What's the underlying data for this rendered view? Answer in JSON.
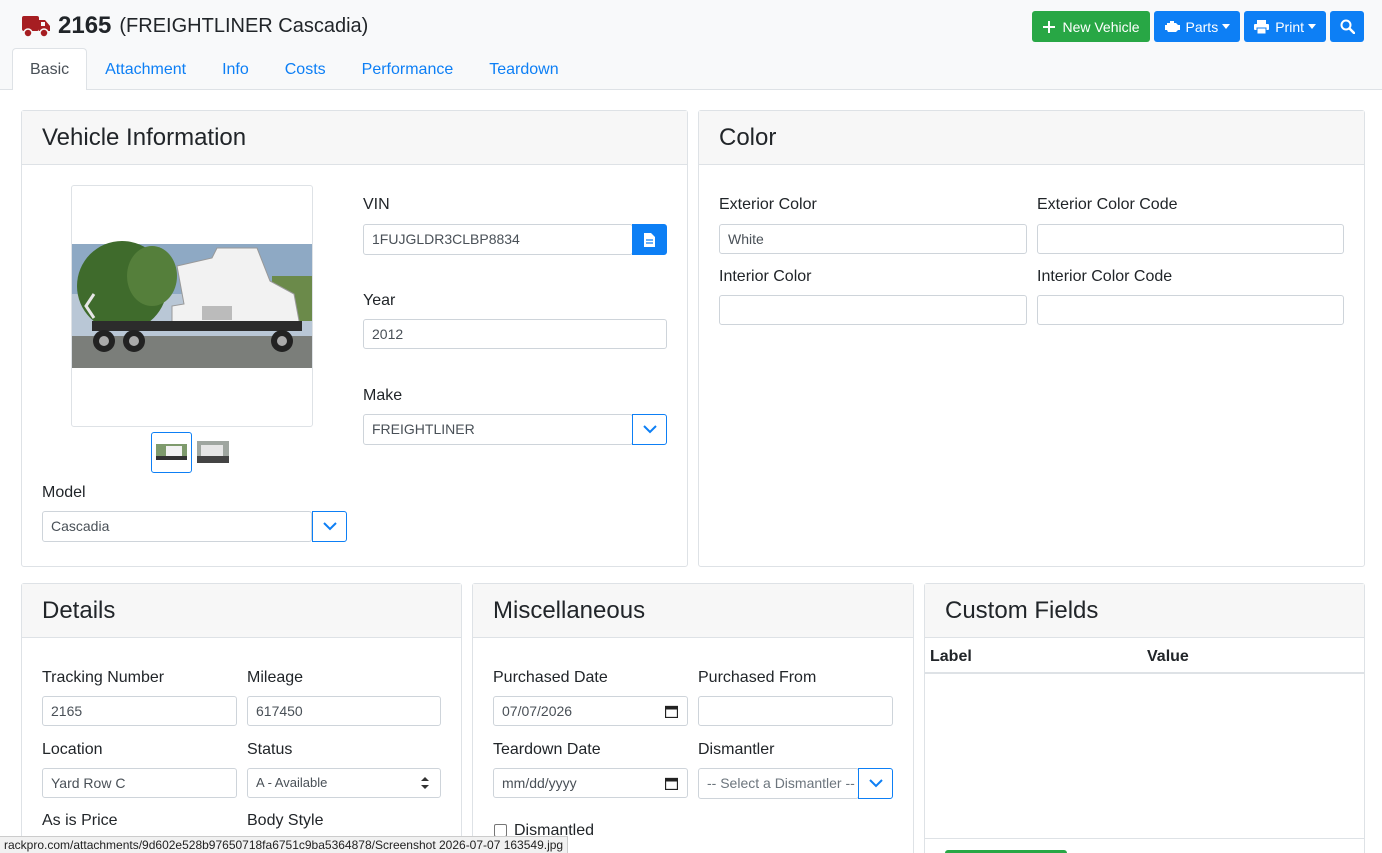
{
  "header": {
    "vehicle_number": "2165",
    "vehicle_name": "(FREIGHTLINER Cascadia)",
    "new_vehicle_label": "New Vehicle",
    "parts_label": "Parts",
    "print_label": "Print"
  },
  "tabs": [
    {
      "label": "Basic",
      "active": true
    },
    {
      "label": "Attachment"
    },
    {
      "label": "Info"
    },
    {
      "label": "Costs"
    },
    {
      "label": "Performance"
    },
    {
      "label": "Teardown"
    }
  ],
  "vehicle_info": {
    "title": "Vehicle Information",
    "vin_label": "VIN",
    "vin_value": "1FUJGLDR3CLBP8834",
    "year_label": "Year",
    "year_value": "2012",
    "make_label": "Make",
    "make_value": "FREIGHTLINER",
    "model_label": "Model",
    "model_value": "Cascadia"
  },
  "color": {
    "title": "Color",
    "exterior_label": "Exterior Color",
    "exterior_value": "White",
    "exterior_code_label": "Exterior Color Code",
    "exterior_code_value": "",
    "interior_label": "Interior Color",
    "interior_value": "",
    "interior_code_label": "Interior Color Code",
    "interior_code_value": ""
  },
  "details": {
    "title": "Details",
    "tracking_label": "Tracking Number",
    "tracking_value": "2165",
    "mileage_label": "Mileage",
    "mileage_value": "617450",
    "location_label": "Location",
    "location_value": "Yard Row C",
    "status_label": "Status",
    "status_value": "A - Available",
    "price_label": "As is Price",
    "body_label": "Body Style"
  },
  "misc": {
    "title": "Miscellaneous",
    "purchased_date_label": "Purchased Date",
    "purchased_date_value": "07/07/2026",
    "purchased_from_label": "Purchased From",
    "purchased_from_value": "",
    "teardown_date_label": "Teardown Date",
    "teardown_date_placeholder": "mm/dd/yyyy",
    "dismantler_label": "Dismantler",
    "dismantler_placeholder": "-- Select a Dismantler --",
    "dismantled_label": "Dismantled"
  },
  "custom_fields": {
    "title": "Custom Fields",
    "col_label": "Label",
    "col_value": "Value"
  },
  "status_bar": {
    "url": "rackpro.com/attachments/9d602e528b97650718fa6751c9ba5364878/Screenshot 2026-07-07 163549.jpg"
  },
  "colors": {
    "brand_red": "#a61e22",
    "primary": "#0d7ff5",
    "success": "#28a745"
  }
}
